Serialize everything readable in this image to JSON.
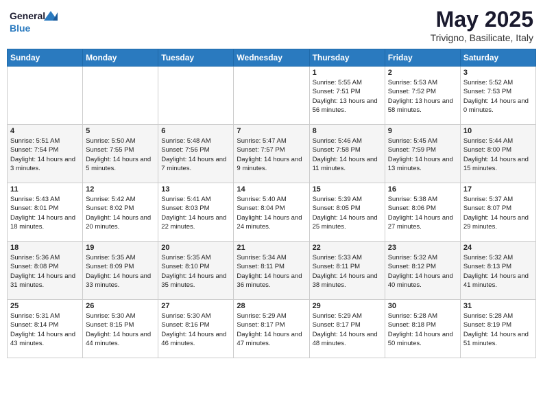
{
  "header": {
    "logo_line1": "General",
    "logo_line2": "Blue",
    "month": "May 2025",
    "location": "Trivigno, Basilicate, Italy"
  },
  "weekdays": [
    "Sunday",
    "Monday",
    "Tuesday",
    "Wednesday",
    "Thursday",
    "Friday",
    "Saturday"
  ],
  "weeks": [
    [
      {
        "day": "",
        "sunrise": "",
        "sunset": "",
        "daylight": ""
      },
      {
        "day": "",
        "sunrise": "",
        "sunset": "",
        "daylight": ""
      },
      {
        "day": "",
        "sunrise": "",
        "sunset": "",
        "daylight": ""
      },
      {
        "day": "",
        "sunrise": "",
        "sunset": "",
        "daylight": ""
      },
      {
        "day": "1",
        "sunrise": "5:55 AM",
        "sunset": "7:51 PM",
        "daylight": "13 hours and 56 minutes."
      },
      {
        "day": "2",
        "sunrise": "5:53 AM",
        "sunset": "7:52 PM",
        "daylight": "13 hours and 58 minutes."
      },
      {
        "day": "3",
        "sunrise": "5:52 AM",
        "sunset": "7:53 PM",
        "daylight": "14 hours and 0 minutes."
      }
    ],
    [
      {
        "day": "4",
        "sunrise": "5:51 AM",
        "sunset": "7:54 PM",
        "daylight": "14 hours and 3 minutes."
      },
      {
        "day": "5",
        "sunrise": "5:50 AM",
        "sunset": "7:55 PM",
        "daylight": "14 hours and 5 minutes."
      },
      {
        "day": "6",
        "sunrise": "5:48 AM",
        "sunset": "7:56 PM",
        "daylight": "14 hours and 7 minutes."
      },
      {
        "day": "7",
        "sunrise": "5:47 AM",
        "sunset": "7:57 PM",
        "daylight": "14 hours and 9 minutes."
      },
      {
        "day": "8",
        "sunrise": "5:46 AM",
        "sunset": "7:58 PM",
        "daylight": "14 hours and 11 minutes."
      },
      {
        "day": "9",
        "sunrise": "5:45 AM",
        "sunset": "7:59 PM",
        "daylight": "14 hours and 13 minutes."
      },
      {
        "day": "10",
        "sunrise": "5:44 AM",
        "sunset": "8:00 PM",
        "daylight": "14 hours and 15 minutes."
      }
    ],
    [
      {
        "day": "11",
        "sunrise": "5:43 AM",
        "sunset": "8:01 PM",
        "daylight": "14 hours and 18 minutes."
      },
      {
        "day": "12",
        "sunrise": "5:42 AM",
        "sunset": "8:02 PM",
        "daylight": "14 hours and 20 minutes."
      },
      {
        "day": "13",
        "sunrise": "5:41 AM",
        "sunset": "8:03 PM",
        "daylight": "14 hours and 22 minutes."
      },
      {
        "day": "14",
        "sunrise": "5:40 AM",
        "sunset": "8:04 PM",
        "daylight": "14 hours and 24 minutes."
      },
      {
        "day": "15",
        "sunrise": "5:39 AM",
        "sunset": "8:05 PM",
        "daylight": "14 hours and 25 minutes."
      },
      {
        "day": "16",
        "sunrise": "5:38 AM",
        "sunset": "8:06 PM",
        "daylight": "14 hours and 27 minutes."
      },
      {
        "day": "17",
        "sunrise": "5:37 AM",
        "sunset": "8:07 PM",
        "daylight": "14 hours and 29 minutes."
      }
    ],
    [
      {
        "day": "18",
        "sunrise": "5:36 AM",
        "sunset": "8:08 PM",
        "daylight": "14 hours and 31 minutes."
      },
      {
        "day": "19",
        "sunrise": "5:35 AM",
        "sunset": "8:09 PM",
        "daylight": "14 hours and 33 minutes."
      },
      {
        "day": "20",
        "sunrise": "5:35 AM",
        "sunset": "8:10 PM",
        "daylight": "14 hours and 35 minutes."
      },
      {
        "day": "21",
        "sunrise": "5:34 AM",
        "sunset": "8:11 PM",
        "daylight": "14 hours and 36 minutes."
      },
      {
        "day": "22",
        "sunrise": "5:33 AM",
        "sunset": "8:11 PM",
        "daylight": "14 hours and 38 minutes."
      },
      {
        "day": "23",
        "sunrise": "5:32 AM",
        "sunset": "8:12 PM",
        "daylight": "14 hours and 40 minutes."
      },
      {
        "day": "24",
        "sunrise": "5:32 AM",
        "sunset": "8:13 PM",
        "daylight": "14 hours and 41 minutes."
      }
    ],
    [
      {
        "day": "25",
        "sunrise": "5:31 AM",
        "sunset": "8:14 PM",
        "daylight": "14 hours and 43 minutes."
      },
      {
        "day": "26",
        "sunrise": "5:30 AM",
        "sunset": "8:15 PM",
        "daylight": "14 hours and 44 minutes."
      },
      {
        "day": "27",
        "sunrise": "5:30 AM",
        "sunset": "8:16 PM",
        "daylight": "14 hours and 46 minutes."
      },
      {
        "day": "28",
        "sunrise": "5:29 AM",
        "sunset": "8:17 PM",
        "daylight": "14 hours and 47 minutes."
      },
      {
        "day": "29",
        "sunrise": "5:29 AM",
        "sunset": "8:17 PM",
        "daylight": "14 hours and 48 minutes."
      },
      {
        "day": "30",
        "sunrise": "5:28 AM",
        "sunset": "8:18 PM",
        "daylight": "14 hours and 50 minutes."
      },
      {
        "day": "31",
        "sunrise": "5:28 AM",
        "sunset": "8:19 PM",
        "daylight": "14 hours and 51 minutes."
      }
    ]
  ],
  "labels": {
    "sunrise": "Sunrise:",
    "sunset": "Sunset:",
    "daylight": "Daylight:"
  }
}
